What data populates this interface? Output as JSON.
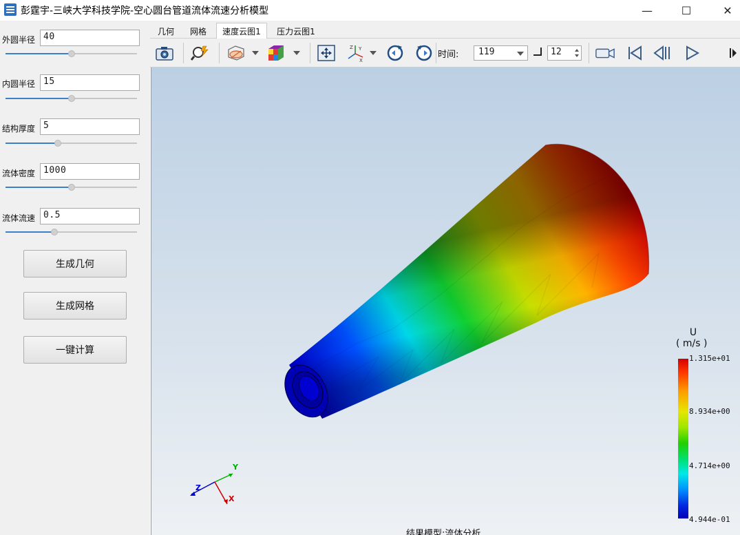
{
  "window": {
    "title": "彭霆宇-三峡大学科技学院-空心圆台管道流体流速分析模型",
    "minimize_glyph": "—",
    "maximize_glyph": "☐",
    "close_glyph": "✕"
  },
  "params": [
    {
      "label": "外圆半径",
      "value": "40",
      "slider_fraction": 0.5
    },
    {
      "label": "内圆半径",
      "value": "15",
      "slider_fraction": 0.5
    },
    {
      "label": "结构厚度",
      "value": "5",
      "slider_fraction": 0.4
    },
    {
      "label": "流体密度",
      "value": "1000",
      "slider_fraction": 0.5
    },
    {
      "label": "流体流速",
      "value": "0.5",
      "slider_fraction": 0.37
    }
  ],
  "buttons": {
    "generate_geometry": "生成几何",
    "generate_mesh": "生成网格",
    "compute": "一键计算"
  },
  "tabs": [
    {
      "label": "几何",
      "active": false
    },
    {
      "label": "网格",
      "active": false
    },
    {
      "label": "速度云图1",
      "active": true
    },
    {
      "label": "压力云图1",
      "active": false
    }
  ],
  "toolbar": {
    "time_label": "时间:",
    "time_value": "119",
    "step_value": "12",
    "icons": [
      "camera-icon",
      "magnify-icon",
      "surface-slice-icon",
      "cube-render-icon",
      "fit-view-icon",
      "axes-icon",
      "rotate-ccw-icon",
      "rotate-cw-icon",
      "record-icon",
      "first-frame-icon",
      "prev-frame-icon",
      "play-icon"
    ]
  },
  "viewport": {
    "bottom_label": "结果模型:流体分析",
    "axes": {
      "x": "X",
      "y": "Y",
      "z": "Z"
    },
    "legend": {
      "title": "U",
      "unit": "( m/s )",
      "ticks": [
        "1.315e+01",
        "8.934e+00",
        "4.714e+00",
        "4.944e-01"
      ]
    }
  },
  "colors": {
    "accent": "#3c7fc6",
    "legend_max": "#d40000",
    "legend_min": "#0000b8"
  }
}
